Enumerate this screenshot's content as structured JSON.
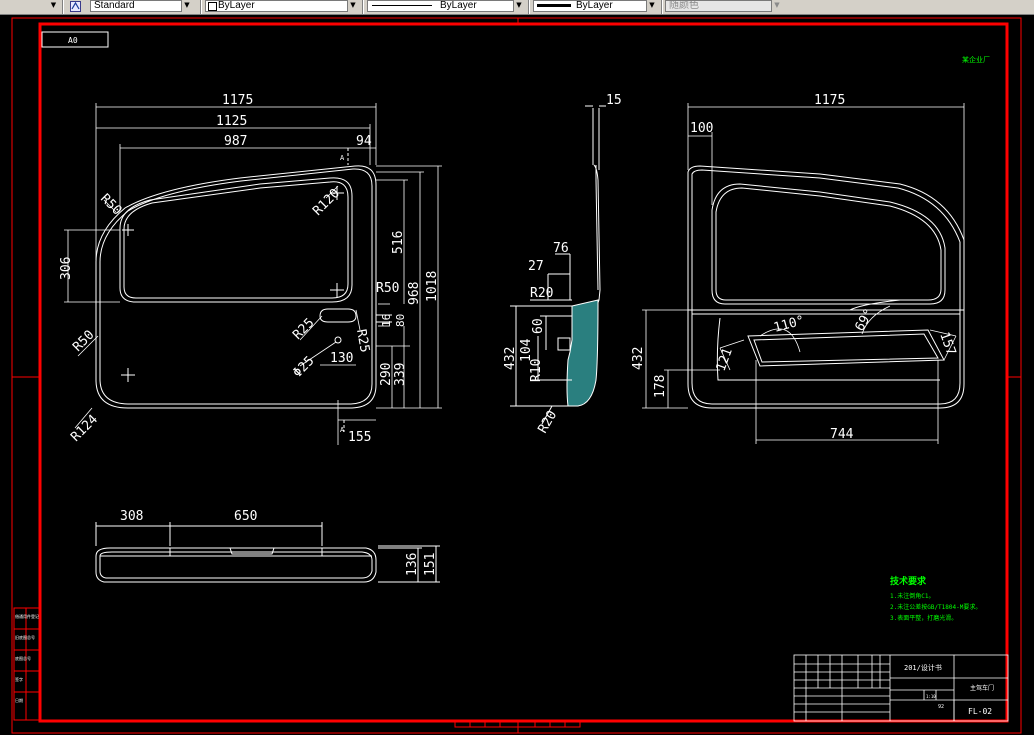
{
  "toolbar": {
    "textstyle": {
      "value": "Standard",
      "icon": "text-style-icon"
    },
    "layer": {
      "value": "ByLayer"
    },
    "linetype": {
      "value": "ByLayer"
    },
    "lineweight": {
      "value": "ByLayer"
    },
    "plotstyle": {
      "value": "随颜色"
    }
  },
  "drawing": {
    "frame_tag": "A0",
    "corner_note": "某企业厂",
    "colors": {
      "background": "#000000",
      "frame": "#ff0000",
      "geometry": "#ffffff",
      "notes": "#00ff00",
      "section_fill": "#2a7f7f"
    },
    "front_view": {
      "dims": [
        "1175",
        "1125",
        "987",
        "94",
        "306",
        "516",
        "968",
        "1018",
        "16",
        "80",
        "290",
        "339",
        "130",
        "155"
      ],
      "radii": [
        "R50",
        "R120",
        "R50",
        "R25",
        "R25",
        "Φ25",
        "R50",
        "R124"
      ],
      "section_mark": "A"
    },
    "side_view": {
      "dims": [
        "15",
        "76",
        "27",
        "R20",
        "60",
        "104",
        "432",
        "R10",
        "R20"
      ]
    },
    "rear_view": {
      "dims": [
        "1175",
        "100",
        "110°",
        "69°",
        "121",
        "157",
        "432",
        "178",
        "744"
      ]
    },
    "bottom_view": {
      "dims": [
        "308",
        "650",
        "136",
        "151"
      ]
    },
    "technical_requirements": {
      "title": "技术要求",
      "items": [
        "1.未注倒角C1。",
        "2.未注公差按GB/T1804-M要求。",
        "3.表面平整，打磨光滑。"
      ]
    },
    "title_block": {
      "project": "201/设计书",
      "part_name": "主驾车门",
      "drawing_no": "FL-02",
      "scale": "1:10",
      "sheet": "92"
    },
    "left_strip_labels": [
      "借通用件登记",
      "旧底图总号",
      "底图总号",
      "签字",
      "日期"
    ]
  }
}
